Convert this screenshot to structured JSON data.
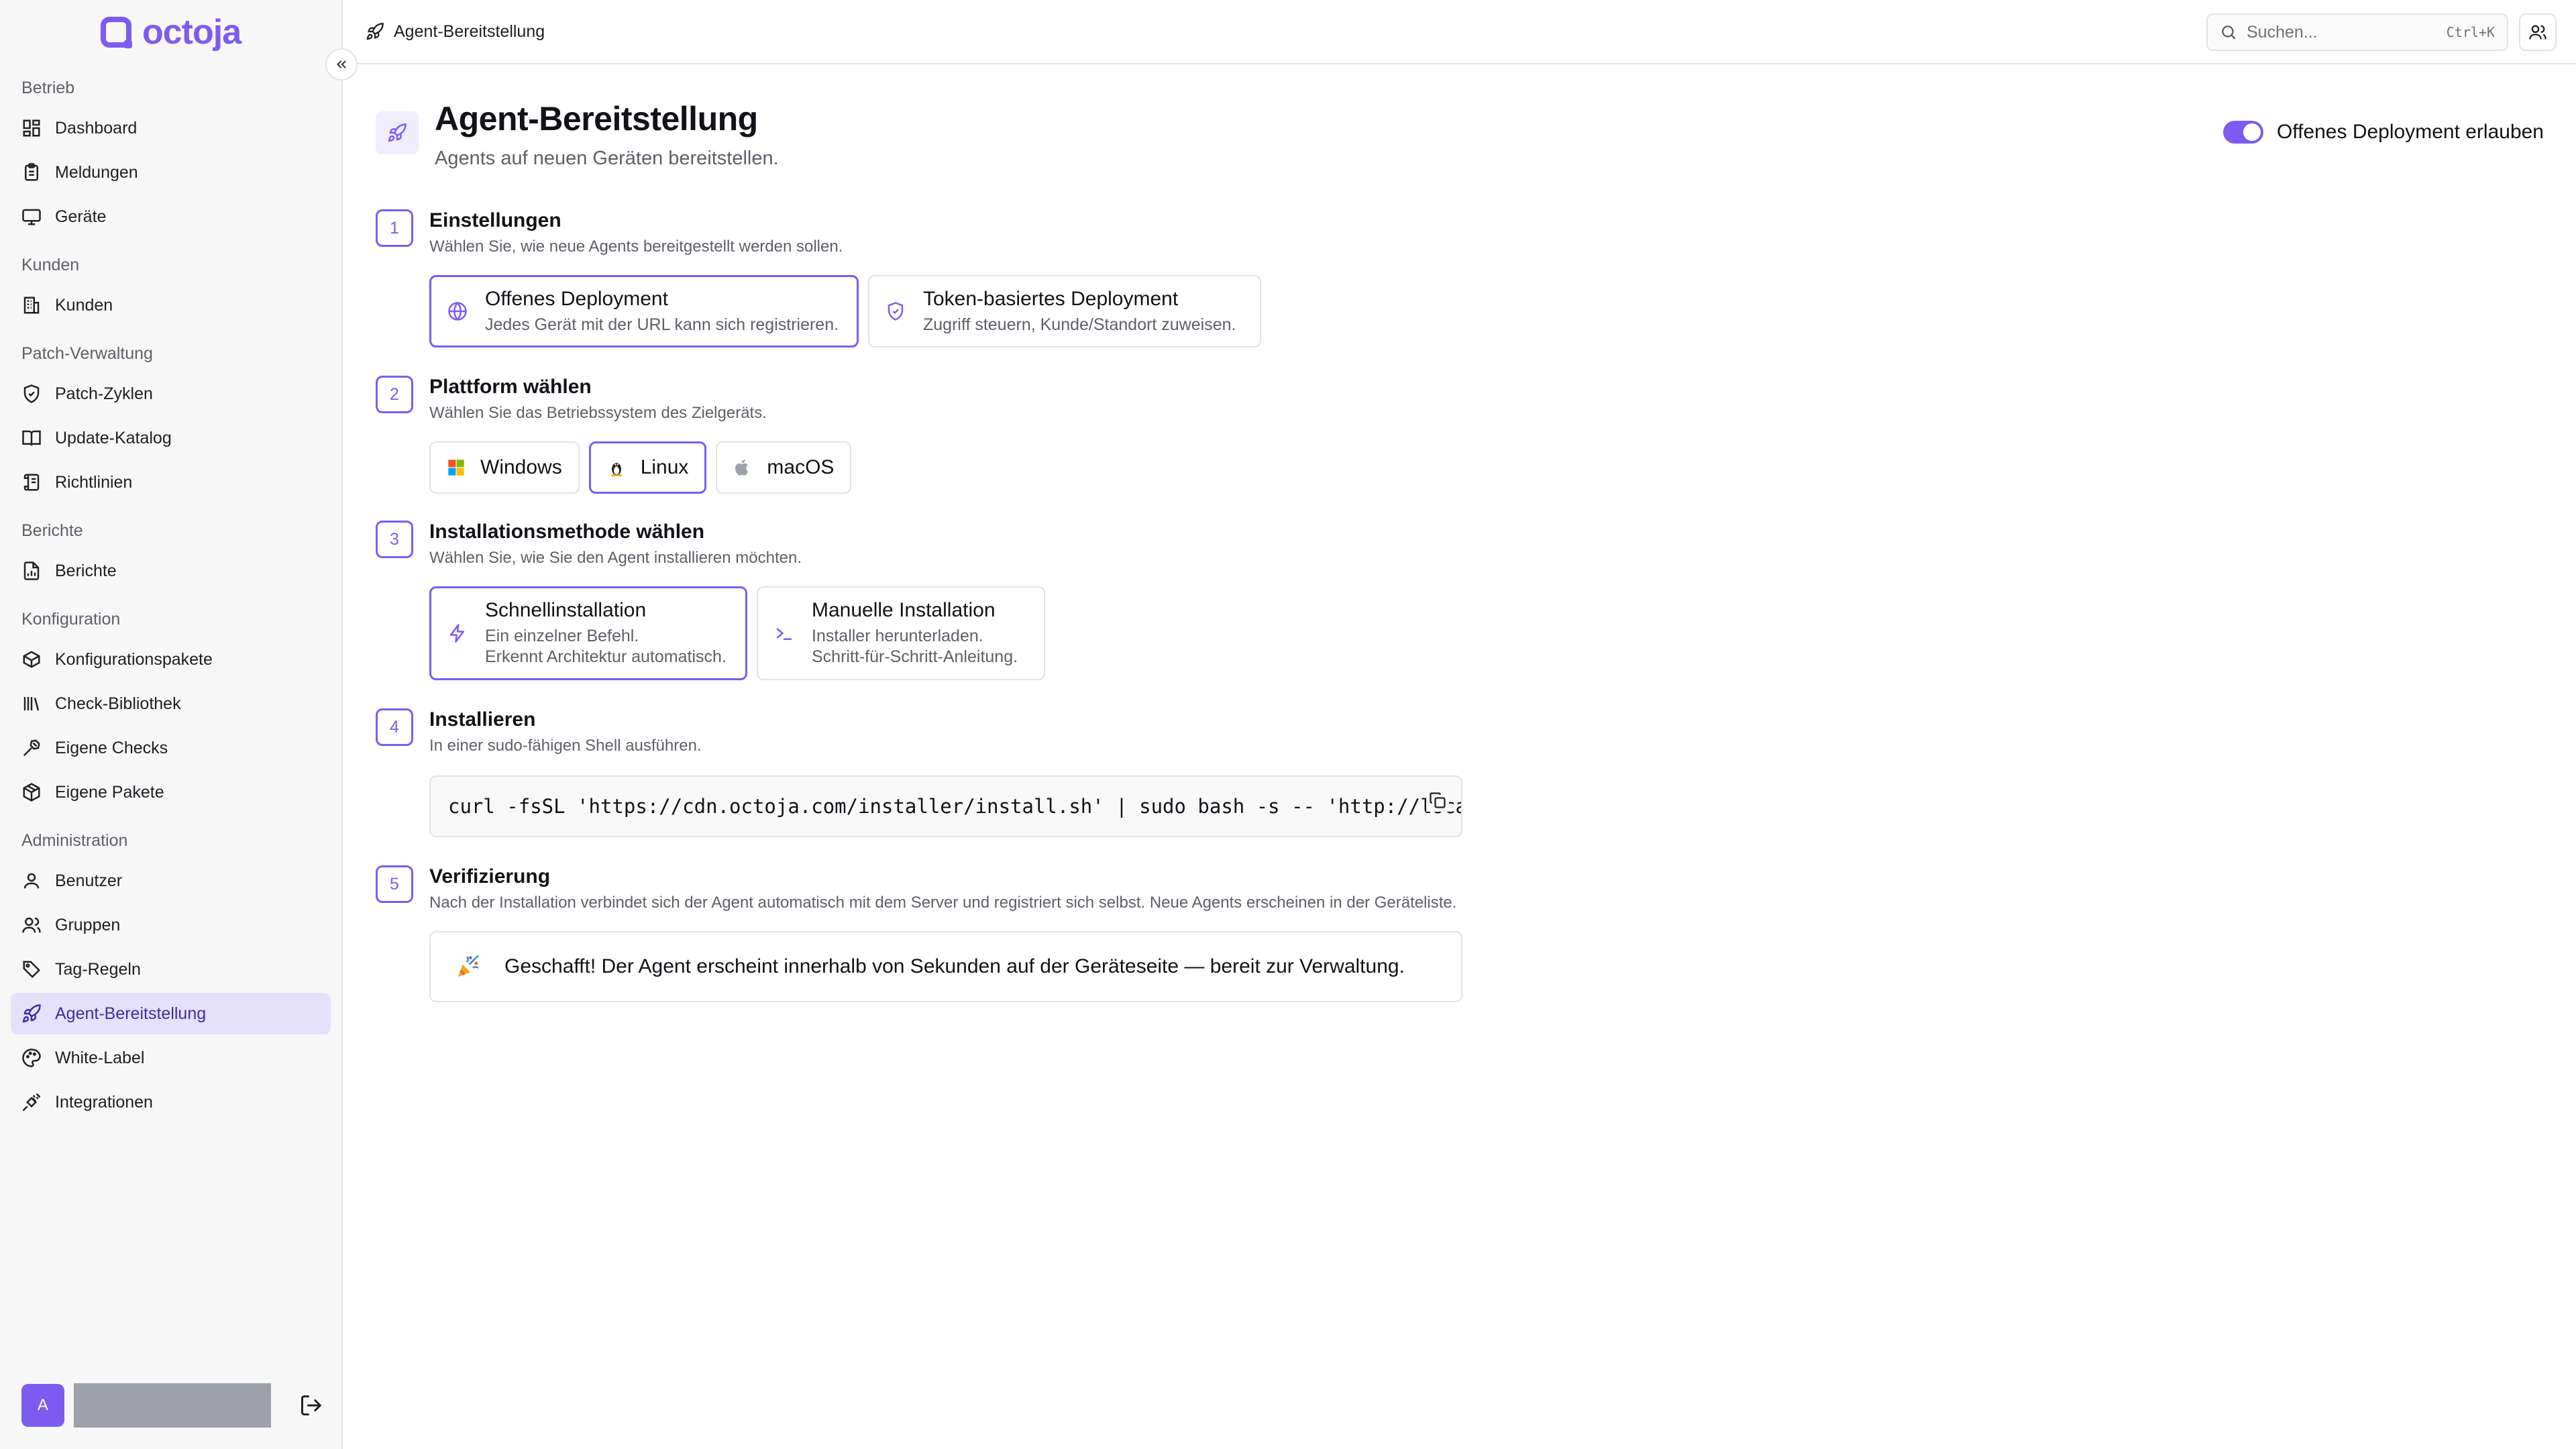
{
  "brand": {
    "name": "octoja",
    "accent": "#7c5cf0"
  },
  "sidebar": {
    "groups": [
      {
        "label": "Betrieb",
        "items": [
          {
            "label": "Dashboard",
            "icon": "dashboard-icon"
          },
          {
            "label": "Meldungen",
            "icon": "clipboard-icon"
          },
          {
            "label": "Geräte",
            "icon": "monitor-icon"
          }
        ]
      },
      {
        "label": "Kunden",
        "items": [
          {
            "label": "Kunden",
            "icon": "building-icon"
          }
        ]
      },
      {
        "label": "Patch-Verwaltung",
        "items": [
          {
            "label": "Patch-Zyklen",
            "icon": "shield-icon"
          },
          {
            "label": "Update-Katalog",
            "icon": "book-icon"
          },
          {
            "label": "Richtlinien",
            "icon": "scroll-icon"
          }
        ]
      },
      {
        "label": "Berichte",
        "items": [
          {
            "label": "Berichte",
            "icon": "report-icon"
          }
        ]
      },
      {
        "label": "Konfiguration",
        "items": [
          {
            "label": "Konfigurationspakete",
            "icon": "package-icon"
          },
          {
            "label": "Check-Bibliothek",
            "icon": "library-icon"
          },
          {
            "label": "Eigene Checks",
            "icon": "hammer-icon"
          },
          {
            "label": "Eigene Pakete",
            "icon": "box-icon"
          }
        ]
      },
      {
        "label": "Administration",
        "items": [
          {
            "label": "Benutzer",
            "icon": "user-icon"
          },
          {
            "label": "Gruppen",
            "icon": "users-icon"
          },
          {
            "label": "Tag-Regeln",
            "icon": "tag-icon"
          },
          {
            "label": "Agent-Bereitstellung",
            "icon": "rocket-icon",
            "active": true
          },
          {
            "label": "White-Label",
            "icon": "palette-icon"
          },
          {
            "label": "Integrationen",
            "icon": "plug-icon"
          }
        ]
      }
    ],
    "user": {
      "initial": "A"
    }
  },
  "topbar": {
    "breadcrumb": "Agent-Bereitstellung",
    "search_placeholder": "Suchen...",
    "search_shortcut": "Ctrl+K"
  },
  "page": {
    "title": "Agent-Bereitstellung",
    "subtitle": "Agents auf neuen Geräten bereitstellen.",
    "toggle_label": "Offenes Deployment erlauben",
    "toggle_on": true
  },
  "steps": {
    "s1": {
      "num": "1",
      "title": "Einstellungen",
      "desc": "Wählen Sie, wie neue Agents bereitgestellt werden sollen.",
      "options": [
        {
          "title": "Offenes Deployment",
          "desc": "Jedes Gerät mit der URL kann sich registrieren.",
          "selected": true
        },
        {
          "title": "Token-basiertes Deployment",
          "desc": "Zugriff steuern, Kunde/Standort zuweisen.",
          "selected": false
        }
      ]
    },
    "s2": {
      "num": "2",
      "title": "Plattform wählen",
      "desc": "Wählen Sie das Betriebssystem des Zielgeräts.",
      "options": [
        {
          "label": "Windows",
          "selected": false
        },
        {
          "label": "Linux",
          "selected": true
        },
        {
          "label": "macOS",
          "selected": false
        }
      ]
    },
    "s3": {
      "num": "3",
      "title": "Installationsmethode wählen",
      "desc": "Wählen Sie, wie Sie den Agent installieren möchten.",
      "options": [
        {
          "title": "Schnellinstallation",
          "line1": "Ein einzelner Befehl.",
          "line2": "Erkennt Architektur automatisch.",
          "selected": true
        },
        {
          "title": "Manuelle Installation",
          "line1": "Installer herunterladen.",
          "line2": "Schritt-für-Schritt-Anleitung.",
          "selected": false
        }
      ]
    },
    "s4": {
      "num": "4",
      "title": "Installieren",
      "desc": "In einer sudo-fähigen Shell ausführen.",
      "command": "curl -fsSL 'https://cdn.octoja.com/installer/install.sh' | sudo bash -s -- 'http://localhost'"
    },
    "s5": {
      "num": "5",
      "title": "Verifizierung",
      "desc": "Nach der Installation verbindet sich der Agent automatisch mit dem Server und registriert sich selbst. Neue Agents erscheinen in der Geräteliste.",
      "success": "Geschafft! Der Agent erscheint innerhalb von Sekunden auf der Geräteseite — bereit zur Verwaltung."
    }
  }
}
